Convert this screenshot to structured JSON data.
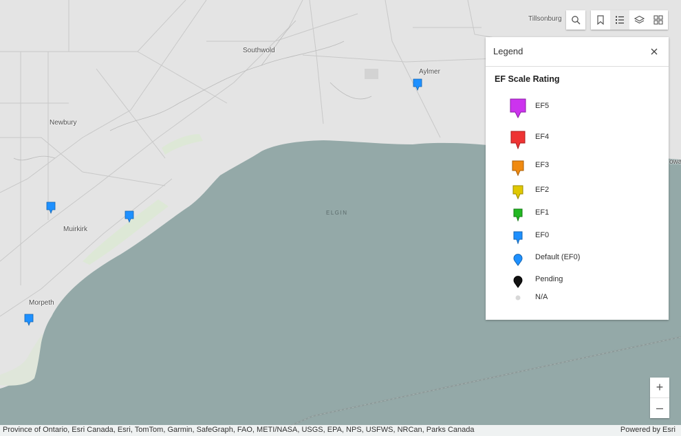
{
  "map": {
    "places": [
      {
        "id": "tillsonburg",
        "label": "Tillsonburg"
      },
      {
        "id": "southwold",
        "label": "Southwold"
      },
      {
        "id": "aylmer",
        "label": "Aylmer"
      },
      {
        "id": "newbury",
        "label": "Newbury"
      },
      {
        "id": "muirkirk",
        "label": "Muirkirk"
      },
      {
        "id": "morpeth",
        "label": "Morpeth"
      },
      {
        "id": "elgin",
        "label": "ELGIN"
      },
      {
        "id": "bayham-partial",
        "label": "owa"
      }
    ],
    "land_color": "#e4e4e4",
    "water_color": "#94a9a8",
    "marker_color": "#1e90ff"
  },
  "toolbar": {
    "search": {
      "icon": "search-icon"
    },
    "tools": [
      {
        "id": "bookmarks",
        "icon": "bookmark-icon",
        "active": false
      },
      {
        "id": "legend",
        "icon": "legend-list-icon",
        "active": true
      },
      {
        "id": "layers",
        "icon": "layers-icon",
        "active": false
      },
      {
        "id": "basemap",
        "icon": "basemap-gallery-icon",
        "active": false
      }
    ]
  },
  "legend": {
    "title": "Legend",
    "layer_title": "EF Scale Rating",
    "items": [
      {
        "label": "EF5",
        "color": "#cc33ee",
        "symbol": "marker-large"
      },
      {
        "label": "EF4",
        "color": "#ee3333",
        "symbol": "marker-large"
      },
      {
        "label": "EF3",
        "color": "#f08a10",
        "symbol": "marker-medium"
      },
      {
        "label": "EF2",
        "color": "#e0c800",
        "symbol": "marker-medium"
      },
      {
        "label": "EF1",
        "color": "#22b822",
        "symbol": "marker-small"
      },
      {
        "label": "EF0",
        "color": "#1e90ff",
        "symbol": "marker-small"
      },
      {
        "label": "Default (EF0)",
        "color": "#1e90ff",
        "symbol": "pin-round"
      },
      {
        "label": "Pending",
        "color": "#111111",
        "symbol": "pin-round"
      },
      {
        "label": "N/A",
        "color": "#d8d8d8",
        "symbol": "dot"
      }
    ]
  },
  "zoom": {
    "in_label": "+",
    "out_label": "–"
  },
  "attribution": {
    "text": "Province of Ontario, Esri Canada, Esri, TomTom, Garmin, SafeGraph, FAO, METI/NASA, USGS, EPA, NPS, USFWS, NRCan, Parks Canada",
    "powered_by": "Powered by Esri"
  }
}
